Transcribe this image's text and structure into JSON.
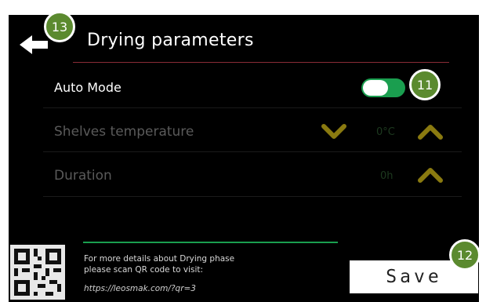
{
  "header": {
    "title": "Drying parameters",
    "back_icon": "back-arrow-icon"
  },
  "settings": {
    "auto_mode": {
      "label": "Auto Mode",
      "enabled": true
    },
    "shelves_temperature": {
      "label": "Shelves temperature",
      "value": "0°C"
    },
    "duration": {
      "label": "Duration",
      "value": "0h"
    }
  },
  "footer": {
    "info_line1": "For more details about Drying phase",
    "info_line2": "please scan QR code to visit:",
    "info_url": "https://leosmak.com/?qr=3",
    "save_label": "Save"
  },
  "badges": {
    "back": "13",
    "toggle": "11",
    "save": "12"
  },
  "colors": {
    "background": "#000000",
    "accent_green": "#1a9e4f",
    "chevron_olive": "#8a7a10",
    "badge_green": "#5b8a2f",
    "rule_red": "#8a2c37"
  }
}
